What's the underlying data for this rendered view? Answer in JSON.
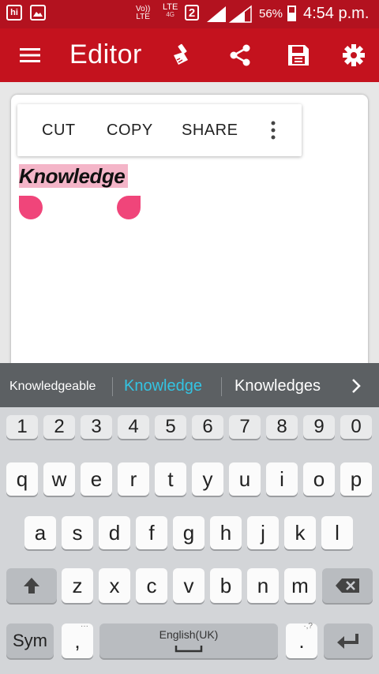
{
  "status_bar": {
    "hike_badge": "hi",
    "network_volte_top": "Vo))",
    "network_volte_bottom": "LTE",
    "lte_top": "LTE",
    "lte_bottom": "4G",
    "sim_slot": "2",
    "battery_percent": "56%",
    "battery_level": 0.56,
    "time": "4:54 p.m."
  },
  "app_bar": {
    "title": "Editor",
    "icons": [
      "menu-icon",
      "clean-brush-icon",
      "share-icon",
      "save-icon",
      "settings-icon"
    ]
  },
  "selection_menu": {
    "cut": "CUT",
    "copy": "COPY",
    "share": "SHARE"
  },
  "editor": {
    "selected_word": "Knowledge"
  },
  "suggestions": {
    "left": "Knowledgeable",
    "center": "Knowledge",
    "right": "Knowledges",
    "accent_color": "#33c4e3"
  },
  "keyboard": {
    "numbers": [
      "1",
      "2",
      "3",
      "4",
      "5",
      "6",
      "7",
      "8",
      "9",
      "0"
    ],
    "row1": [
      "q",
      "w",
      "e",
      "r",
      "t",
      "y",
      "u",
      "i",
      "o",
      "p"
    ],
    "row2": [
      "a",
      "s",
      "d",
      "f",
      "g",
      "h",
      "j",
      "k",
      "l"
    ],
    "row3": [
      "z",
      "x",
      "c",
      "v",
      "b",
      "n",
      "m"
    ],
    "sym": "Sym",
    "comma": ",",
    "comma_hint": "···",
    "space_language": "English(UK)",
    "period": ".",
    "period_hint": "·,?"
  },
  "colors": {
    "status_bar": "#b3121f",
    "app_bar": "#c4121e",
    "selection_highlight": "#f4b5c8",
    "selection_handle": "#f0457a"
  }
}
